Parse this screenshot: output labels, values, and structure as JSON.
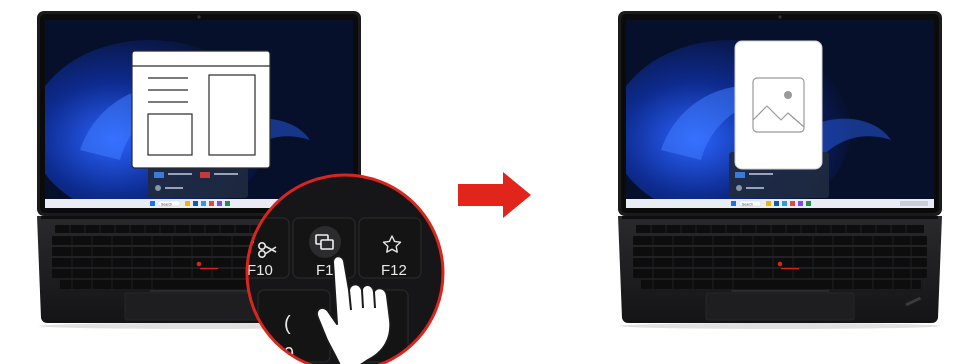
{
  "keys": {
    "f10": "F10",
    "f11": "F11",
    "f12": "F12"
  },
  "search_label": "Search",
  "icons": {
    "before_overlay": "layout-window-icon",
    "after_overlay": "image-placeholder-icon",
    "key_f10": "snipping-icon",
    "key_f11": "window-switch-icon",
    "key_f12": "star-icon",
    "arrow": "right-arrow-icon",
    "hand": "pointing-hand-icon"
  },
  "colors": {
    "arrow": "#e1251b",
    "callout_border": "#d9261c",
    "wallpaper": "#0a1533",
    "laptop_body": "#1c1c1e",
    "keycap": "#141414"
  }
}
